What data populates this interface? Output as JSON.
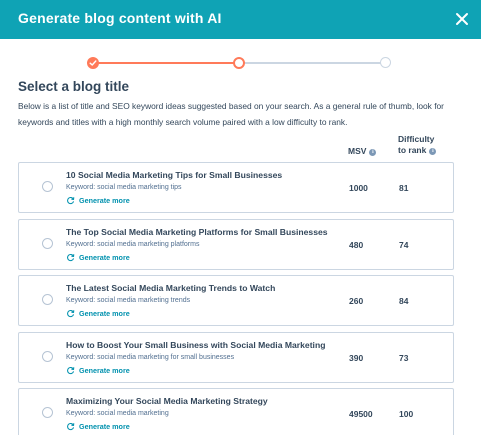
{
  "header": {
    "title": "Generate blog content with AI"
  },
  "colors": {
    "header_bg": "#0fa3b5",
    "accent_orange": "#ff7a59",
    "link_blue": "#0091ae",
    "text_primary": "#33475b"
  },
  "stepper": {
    "current_step": 2,
    "total_steps": 3
  },
  "section": {
    "title": "Select a blog title",
    "description": "Below is a list of title and SEO keyword ideas suggested based on your search. As a general rule of thumb, look for keywords and titles with a high monthly search volume paired with a low difficulty to rank."
  },
  "columns": {
    "msv": "MSV",
    "difficulty_line1": "Difficulty",
    "difficulty_line2": "to rank",
    "info_icon": "info-icon"
  },
  "rows": [
    {
      "title": "10 Social Media Marketing Tips for Small Businesses",
      "keyword": "Keyword: social media marketing tips",
      "action": "Generate more",
      "msv": "1000",
      "difficulty": "81"
    },
    {
      "title": "The Top Social Media Marketing Platforms for Small Businesses",
      "keyword": "Keyword: social media marketing platforms",
      "action": "Generate more",
      "msv": "480",
      "difficulty": "74"
    },
    {
      "title": "The Latest Social Media Marketing Trends to Watch",
      "keyword": "Keyword: social media marketing trends",
      "action": "Generate more",
      "msv": "260",
      "difficulty": "84"
    },
    {
      "title": "How to Boost Your Small Business with Social Media Marketing",
      "keyword": "Keyword: social media marketing for small businesses",
      "action": "Generate more",
      "msv": "390",
      "difficulty": "73"
    },
    {
      "title": "Maximizing Your Social Media Marketing Strategy",
      "keyword": "Keyword: social media marketing",
      "action": "Generate more",
      "msv": "49500",
      "difficulty": "100"
    }
  ]
}
